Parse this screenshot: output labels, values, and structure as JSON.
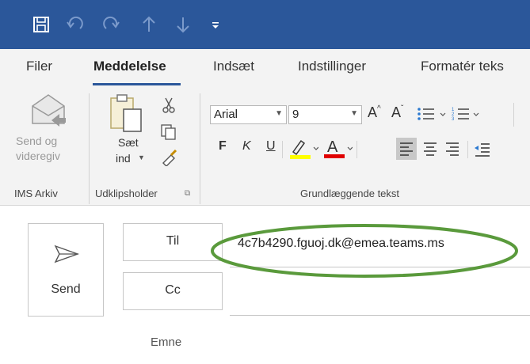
{
  "qat": {
    "icons": [
      "save-icon",
      "undo-icon",
      "redo-icon",
      "up-arrow-icon",
      "down-arrow-icon",
      "customize-icon"
    ],
    "bg_color": "#2b579a"
  },
  "tabs": [
    {
      "label": "Filer"
    },
    {
      "label": "Meddelelse",
      "active": true
    },
    {
      "label": "Indsæt"
    },
    {
      "label": "Indstillinger"
    },
    {
      "label": "Formatér teks"
    }
  ],
  "ribbon": {
    "ims": {
      "send_forward_label": "Send og videregiv",
      "send_line1": "Send og",
      "send_line2": "videregiv",
      "group_label": "IMS Arkiv"
    },
    "clipboard": {
      "paste_line1": "Sæt",
      "paste_line2": "ind",
      "group_label": "Udklipsholder"
    },
    "font": {
      "font_name": "Arial",
      "font_size": "9",
      "bold": "F",
      "italic": "K",
      "underline": "U",
      "group_label": "Grundlæggende tekst",
      "highlight_color": "#ffff00",
      "font_color": "#e00000"
    }
  },
  "compose": {
    "send_label": "Send",
    "to_label": "Til",
    "cc_label": "Cc",
    "subject_label": "Emne",
    "to_value": "4c7b4290.fguoj.dk@emea.teams.ms",
    "highlight_ellipse_color": "#5a9a3c"
  }
}
